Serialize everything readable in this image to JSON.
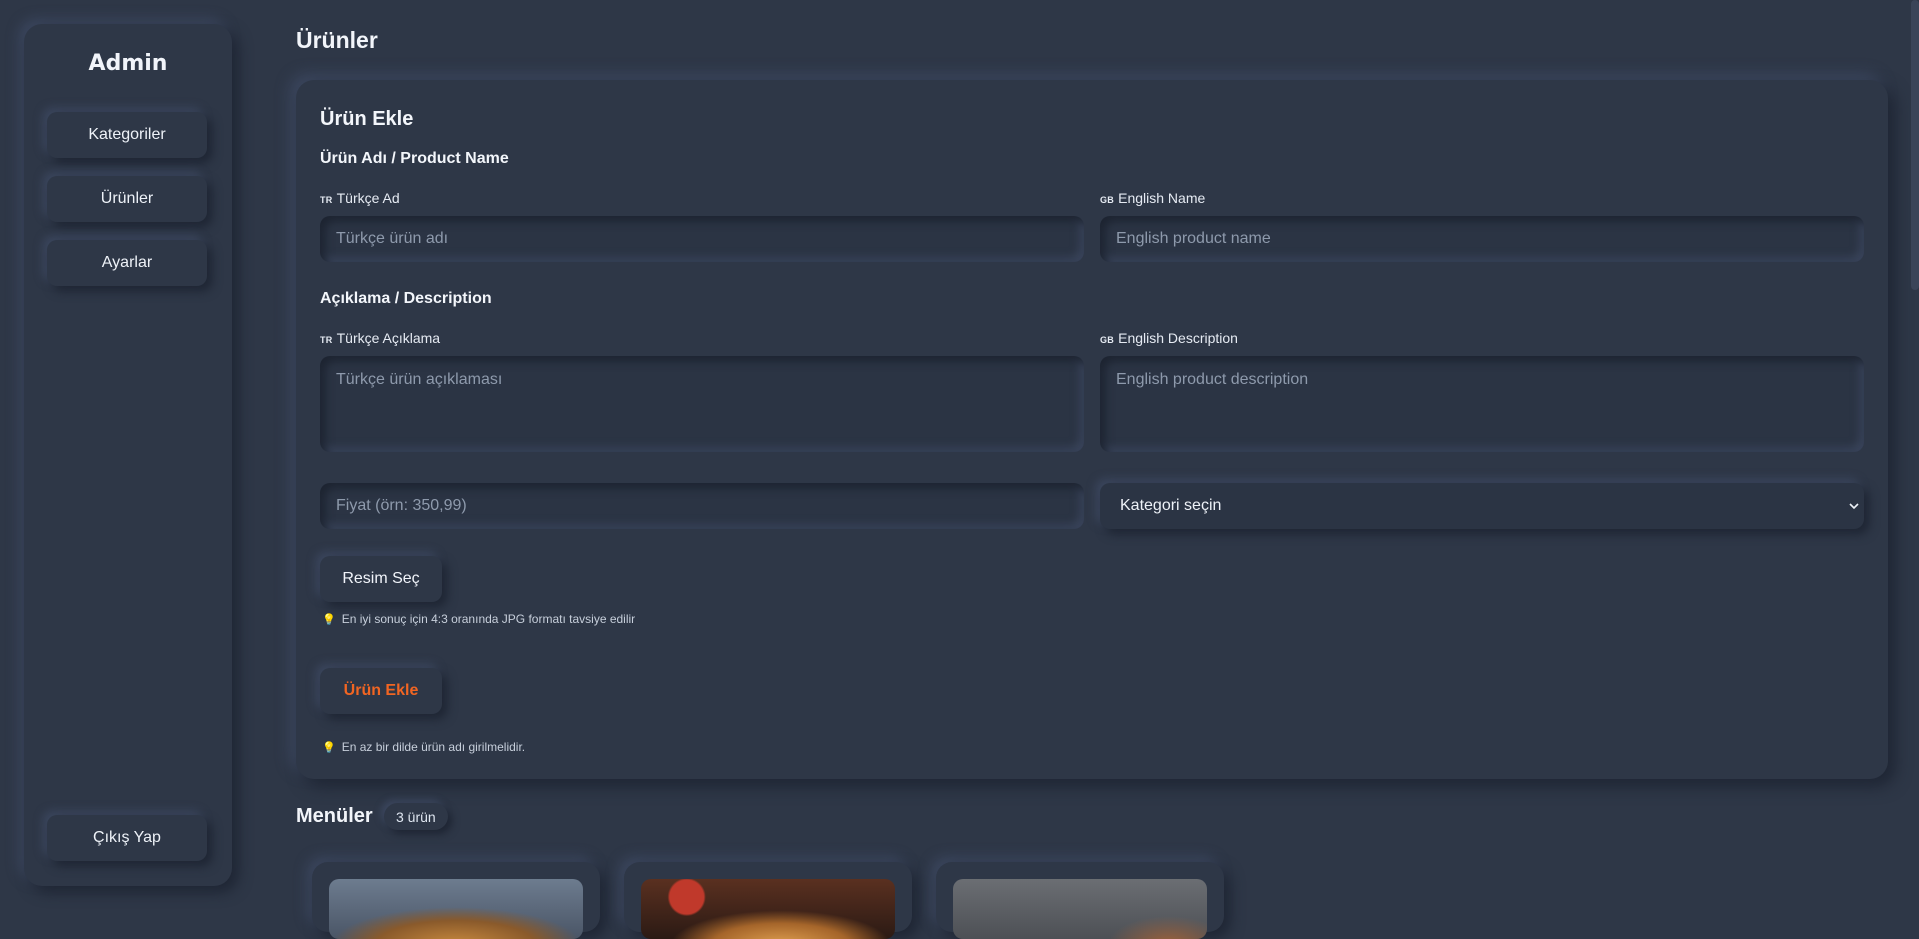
{
  "sidebar": {
    "brand": "Admin",
    "items": [
      {
        "label": "Kategoriler"
      },
      {
        "label": "Ürünler"
      },
      {
        "label": "Ayarlar"
      }
    ],
    "logout_label": "Çıkış Yap"
  },
  "page": {
    "title": "Ürünler"
  },
  "form": {
    "title": "Ürün Ekle",
    "name_section": "Ürün Adı / Product Name",
    "name_tr_flag": "TR",
    "name_tr_label": "Türkçe Ad",
    "name_tr_placeholder": "Türkçe ürün adı",
    "name_en_flag": "GB",
    "name_en_label": "English Name",
    "name_en_placeholder": "English product name",
    "desc_section": "Açıklama / Description",
    "desc_tr_flag": "TR",
    "desc_tr_label": "Türkçe Açıklama",
    "desc_tr_placeholder": "Türkçe ürün açıklaması",
    "desc_en_flag": "GB",
    "desc_en_label": "English Description",
    "desc_en_placeholder": "English product description",
    "price_placeholder": "Fiyat (örn: 350,99)",
    "category_selected": "Kategori seçin",
    "image_button": "Resim Seç",
    "image_hint": "En iyi sonuç için 4:3 oranında JPG formatı tavsiye edilir",
    "submit_label": "Ürün Ekle",
    "submit_color": "#f26522",
    "submit_hint": "En az bir dilde ürün adı girilmelidir."
  },
  "menu_section": {
    "title": "Menüler",
    "count": "3 ürün"
  },
  "colors": {
    "background": "#2e3747",
    "text": "#e8edf5",
    "placeholder": "#8e9aac",
    "accent": "#f26522",
    "hint_icon": "#f2c94c"
  },
  "icons": {
    "hint": "lightbulb-icon",
    "select": "chevron-down-icon"
  }
}
